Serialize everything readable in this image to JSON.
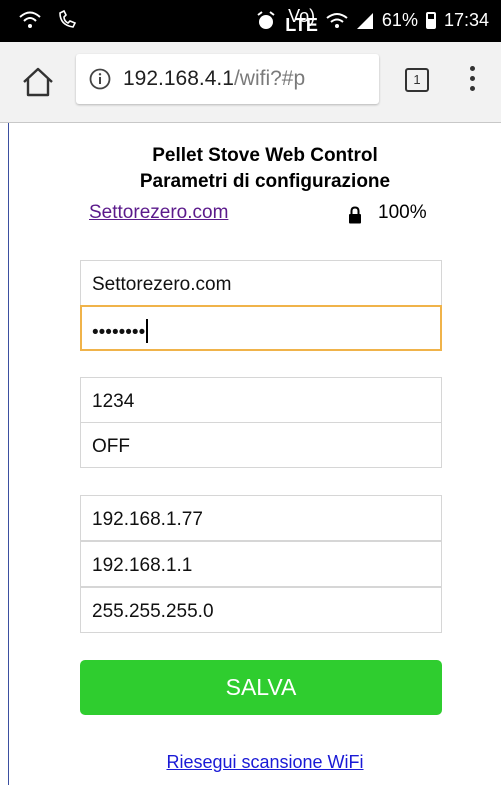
{
  "status_bar": {
    "network_type": "LTE",
    "battery_percent": "61%",
    "battery_level": 0.61,
    "time": "17:34"
  },
  "browser": {
    "url_host": "192.168.4.1",
    "url_path": "/wifi?#p",
    "tab_count": "1"
  },
  "page": {
    "title_line1": "Pellet Stove Web Control",
    "title_line2": "Parametri di configurazione",
    "network_link": "Settorezero.com",
    "signal_strength": "100%",
    "fields": {
      "ssid": "Settorezero.com",
      "password": "••••••••",
      "field_pin": "1234",
      "field_mode": "OFF",
      "ip_address": "192.168.1.77",
      "gateway": "192.168.1.1",
      "subnet": "255.255.255.0"
    },
    "save_button": "SALVA",
    "rescan_link": "Riesegui scansione WiFi"
  },
  "colors": {
    "save_button": "#2fcd2f",
    "link_visited": "#5b1a8b",
    "link": "#1a1ad6",
    "focus_border": "#f0b34a"
  }
}
